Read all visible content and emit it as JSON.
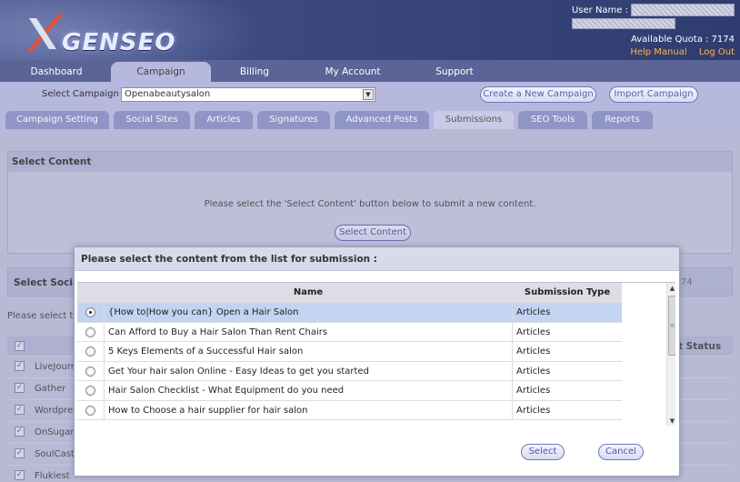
{
  "header": {
    "logo_text": "GENSEO",
    "user_label": "User Name :",
    "quota_label": "Available Quota : 7174",
    "help_link": "Help Manual",
    "logout_link": "Log Out"
  },
  "nav": {
    "items": [
      {
        "label": "Dashboard"
      },
      {
        "label": "Campaign"
      },
      {
        "label": "Billing"
      },
      {
        "label": "My Account"
      },
      {
        "label": "Support"
      }
    ],
    "active": "Campaign"
  },
  "campaign_bar": {
    "select_label": "Select Campaign :",
    "selected": "Openabeautysalon",
    "create_button": "Create a New Campaign",
    "import_button": "Import Campaign"
  },
  "subtabs": {
    "items": [
      {
        "label": "Campaign Setting"
      },
      {
        "label": "Social Sites"
      },
      {
        "label": "Articles"
      },
      {
        "label": "Signatures"
      },
      {
        "label": "Advanced Posts"
      },
      {
        "label": "Submissions"
      },
      {
        "label": "SEO Tools"
      },
      {
        "label": "Reports"
      }
    ],
    "active": "Submissions"
  },
  "select_content": {
    "title": "Select Content",
    "message": "Please select the 'Select Content' button below to submit a new content.",
    "button": "Select Content"
  },
  "social": {
    "title": "Select Social",
    "right_fragment": "74",
    "please_text": "Please select th",
    "status_header": "t Status",
    "rows": [
      {
        "name": "LiveJourn"
      },
      {
        "name": "Gather"
      },
      {
        "name": "Wordpres"
      },
      {
        "name": "OnSugar"
      },
      {
        "name": "SoulCast"
      },
      {
        "name": "Flukiest"
      }
    ]
  },
  "modal": {
    "title": "Please select the content from the list for submission :",
    "columns": {
      "name": "Name",
      "type": "Submission Type"
    },
    "rows": [
      {
        "name": "{How to|How you can} Open a Hair Salon",
        "type": "Articles",
        "selected": true
      },
      {
        "name": "Can Afford to Buy a Hair Salon Than Rent Chairs",
        "type": "Articles",
        "selected": false
      },
      {
        "name": "5 Keys Elements of a Successful Hair salon",
        "type": "Articles",
        "selected": false
      },
      {
        "name": "Get Your hair salon Online - Easy Ideas to get you started",
        "type": "Articles",
        "selected": false
      },
      {
        "name": "Hair Salon Checklist - What Equipment do you need",
        "type": "Articles",
        "selected": false
      },
      {
        "name": "How to Choose a hair supplier for hair salon",
        "type": "Articles",
        "selected": false
      }
    ],
    "select_button": "Select",
    "cancel_button": "Cancel"
  },
  "colors": {
    "accent": "#5560a8",
    "header_bg": "#3c4a80",
    "link_orange": "#ffb347",
    "selected_row": "#c3d3f2"
  }
}
